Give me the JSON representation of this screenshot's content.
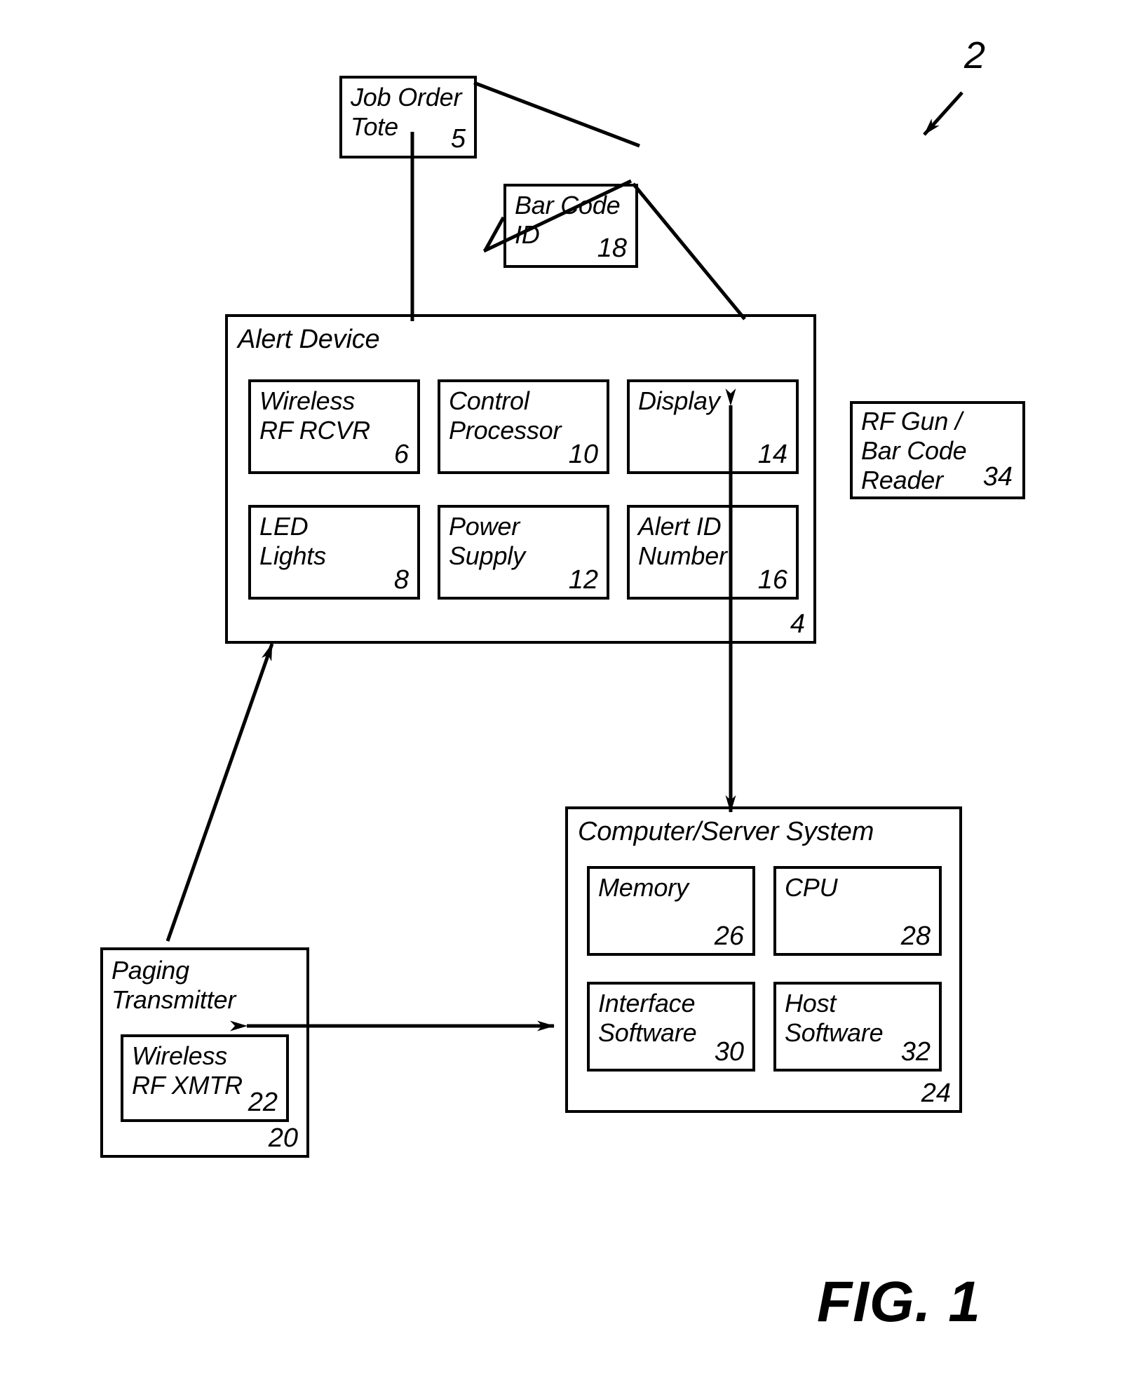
{
  "figure": {
    "caption": "FIG. 1",
    "system_reference": "2"
  },
  "nodes": {
    "job_order_tote": {
      "title": "Job Order\nTote",
      "ref": "5"
    },
    "bar_code_id": {
      "title": "Bar Code\nID",
      "ref": "18"
    },
    "alert_device": {
      "title": "Alert Device",
      "ref": "4",
      "children": [
        {
          "title": "Wireless\nRF RCVR",
          "ref": "6"
        },
        {
          "title": "Control\nProcessor",
          "ref": "10"
        },
        {
          "title": "Display",
          "ref": "14"
        },
        {
          "title": "LED\nLights",
          "ref": "8"
        },
        {
          "title": "Power\nSupply",
          "ref": "12"
        },
        {
          "title": "Alert ID\nNumber",
          "ref": "16"
        }
      ]
    },
    "rf_gun": {
      "title": "RF Gun /\nBar Code\nReader",
      "ref": "34"
    },
    "computer_server": {
      "title": "Computer/Server System",
      "ref": "24",
      "children": [
        {
          "title": "Memory",
          "ref": "26"
        },
        {
          "title": "CPU",
          "ref": "28"
        },
        {
          "title": "Interface\nSoftware",
          "ref": "30"
        },
        {
          "title": "Host\nSoftware",
          "ref": "32"
        }
      ]
    },
    "paging_transmitter": {
      "title": "Paging\nTransmitter",
      "ref": "20",
      "children": [
        {
          "title": "Wireless\nRF XMTR",
          "ref": "22"
        }
      ]
    }
  }
}
